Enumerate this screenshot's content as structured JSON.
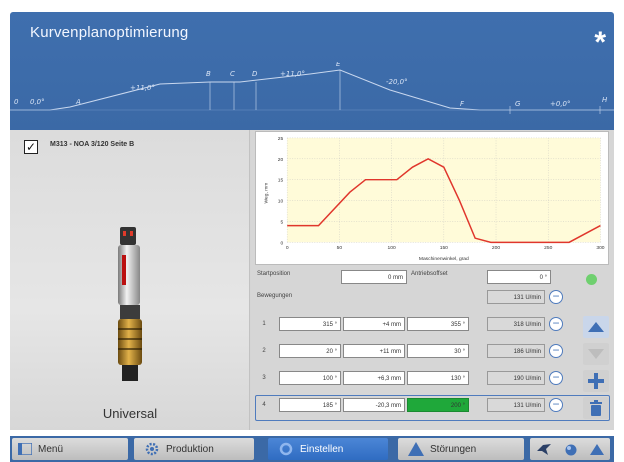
{
  "header": {
    "title": "Kurvenplanoptimierung",
    "star": "*",
    "profile_labels": [
      "0",
      "0,0°",
      "A",
      "+11,0°",
      "B",
      "C",
      "D",
      "+11,0°",
      "E",
      "-20,0°",
      "F",
      "G",
      "+0,0°",
      "H"
    ]
  },
  "device": {
    "checked": "✓",
    "name": "M313 - NOA 3/120 Seite B",
    "type_label": "Universal"
  },
  "chart_data": {
    "type": "line",
    "x": [
      0,
      30,
      60,
      75,
      90,
      105,
      120,
      135,
      150,
      165,
      180,
      195,
      210,
      225,
      240,
      255,
      270,
      285,
      300
    ],
    "y": [
      4,
      4,
      12,
      15,
      15,
      15,
      18,
      20,
      18,
      10,
      1,
      0,
      0,
      0,
      0,
      0,
      0,
      2,
      4
    ],
    "xlabel": "Maschinenwinkel, grad",
    "ylabel": "Weg, mm",
    "xlim": [
      0,
      300
    ],
    "ylim": [
      0,
      25
    ],
    "xticks": [
      "0",
      "50",
      "100",
      "150",
      "200",
      "250",
      "300"
    ],
    "yticks": [
      "0",
      "5",
      "10",
      "15",
      "20",
      "25"
    ],
    "grid": true,
    "line_color": "#e0362c",
    "background": "#fffbd9"
  },
  "params": {
    "startpos_label": "Startposition",
    "startpos_value": "0 mm",
    "antriebsoffset_label": "Antriebsoffset",
    "antriebsoffset_value": "0 °",
    "bewegungen_label": "Bewegungen",
    "total_ticks": "131 U/min"
  },
  "moves": [
    {
      "num": "1",
      "angle": "315 °",
      "dist": "+4 mm",
      "speed": "355 °",
      "ticks": "318 U/min"
    },
    {
      "num": "2",
      "angle": "20 °",
      "dist": "+11 mm",
      "speed": "30 °",
      "ticks": "186 U/min"
    },
    {
      "num": "3",
      "angle": "100 °",
      "dist": "+6,3 mm",
      "speed": "130 °",
      "ticks": "190 U/min"
    },
    {
      "num": "4",
      "angle": "185 °",
      "dist": "-20,3 mm",
      "speed": "200 °",
      "ticks": "131 U/min"
    }
  ],
  "colors": {
    "header_blue": "#3b69a6",
    "accent_blue": "#4f7bbd",
    "active_tab": "#2f6cc2",
    "green": "#1fa83a"
  },
  "nav": {
    "menu": "Menü",
    "produktion": "Produktion",
    "einstellen": "Einstellen",
    "stoerungen": "Störungen"
  }
}
